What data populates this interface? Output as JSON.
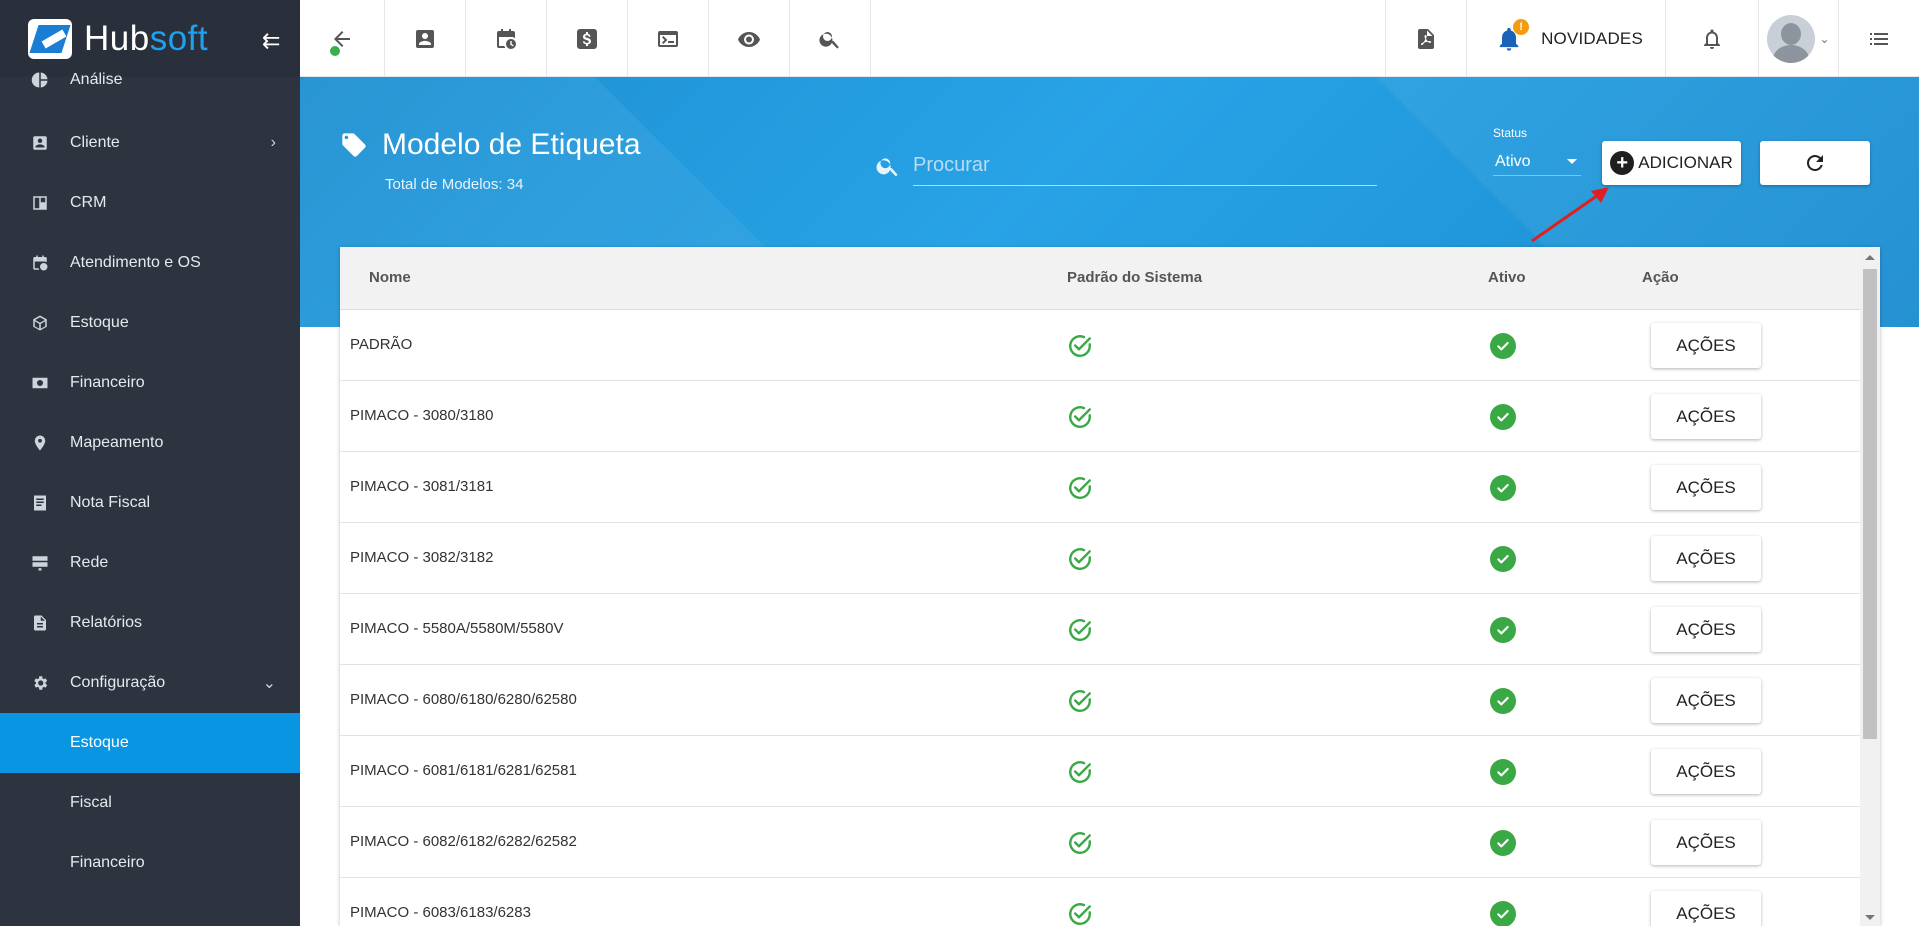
{
  "brand": {
    "name_a": "Hub",
    "name_b": "soft"
  },
  "sidebar": {
    "items": [
      {
        "label": "Análise",
        "icon": "pie-chart-icon"
      },
      {
        "label": "Cliente",
        "icon": "contact-card-icon",
        "chevron": "right"
      },
      {
        "label": "CRM",
        "icon": "kanban-board-icon"
      },
      {
        "label": "Atendimento e OS",
        "icon": "calendar-clock-icon"
      },
      {
        "label": "Estoque",
        "icon": "box-icon"
      },
      {
        "label": "Financeiro",
        "icon": "money-icon"
      },
      {
        "label": "Mapeamento",
        "icon": "map-pin-icon"
      },
      {
        "label": "Nota Fiscal",
        "icon": "receipt-icon"
      },
      {
        "label": "Rede",
        "icon": "server-icon"
      },
      {
        "label": "Relatórios",
        "icon": "document-icon"
      },
      {
        "label": "Configuração",
        "icon": "gear-icon",
        "chevron": "down"
      }
    ],
    "subitems": [
      {
        "label": "Estoque",
        "active": true
      },
      {
        "label": "Fiscal"
      },
      {
        "label": "Financeiro"
      }
    ]
  },
  "topbar": {
    "icons": [
      "back-arrow-icon",
      "contact-card-icon",
      "calendar-clock-icon",
      "dollar-icon",
      "terminal-icon",
      "eye-icon",
      "search-icon"
    ],
    "right_icons": [
      "pdf-icon",
      "bell-icon",
      "user-avatar",
      "list-menu-icon"
    ],
    "novidades_label": "NOVIDADES",
    "novidades_badge": "!"
  },
  "header": {
    "title": "Modelo de Etiqueta",
    "subtitle": "Total de Modelos: 34",
    "search_placeholder": "Procurar",
    "status_label": "Status",
    "status_value": "Ativo",
    "add_button_label": "ADICIONAR"
  },
  "table": {
    "columns": [
      "Nome",
      "Padrão do Sistema",
      "Ativo",
      "Ação"
    ],
    "action_label": "AÇÕES",
    "rows": [
      {
        "nome": "PADRÃO",
        "padrao": true,
        "ativo": true
      },
      {
        "nome": "PIMACO - 3080/3180",
        "padrao": true,
        "ativo": true
      },
      {
        "nome": "PIMACO - 3081/3181",
        "padrao": true,
        "ativo": true
      },
      {
        "nome": "PIMACO - 3082/3182",
        "padrao": true,
        "ativo": true
      },
      {
        "nome": "PIMACO - 5580A/5580M/5580V",
        "padrao": true,
        "ativo": true
      },
      {
        "nome": "PIMACO - 6080/6180/6280/62580",
        "padrao": true,
        "ativo": true
      },
      {
        "nome": "PIMACO - 6081/6181/6281/62581",
        "padrao": true,
        "ativo": true
      },
      {
        "nome": "PIMACO - 6082/6182/6282/62582",
        "padrao": true,
        "ativo": true
      },
      {
        "nome": "PIMACO - 6083/6183/6283",
        "padrao": true,
        "ativo": true
      }
    ]
  },
  "colors": {
    "sidebar_bg": "#2d3440",
    "accent": "#0a95e3",
    "header_blue": "#1c8fd1",
    "success": "#3aa845"
  }
}
